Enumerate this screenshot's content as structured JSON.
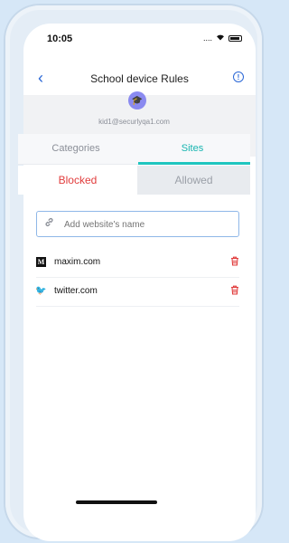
{
  "status": {
    "time": "10:05",
    "signal": "....",
    "wifi": "wifi-icon",
    "battery": "battery-icon"
  },
  "nav": {
    "back": "‹",
    "title": "School device Rules",
    "info": "!"
  },
  "profile": {
    "avatar_icon": "graduation-cap-icon",
    "avatar_glyph": "🎓",
    "email": "kid1@securlyqa1.com"
  },
  "tabs": {
    "categories": "Categories",
    "sites": "Sites",
    "active": "Sites"
  },
  "subtabs": {
    "blocked": "Blocked",
    "allowed": "Allowed",
    "active": "Blocked"
  },
  "search": {
    "placeholder": "Add website's name",
    "value": "",
    "icon": "link-icon"
  },
  "sites": [
    {
      "name": "maxim.com",
      "icon": "maxim-logo-icon",
      "glyph": "M"
    },
    {
      "name": "twitter.com",
      "icon": "twitter-logo-icon",
      "glyph": "🐦"
    }
  ],
  "colors": {
    "accent": "#2a67d6",
    "teal": "#1fc5bf",
    "blocked_red": "#e13c3c",
    "avatar": "#8a8af0"
  }
}
